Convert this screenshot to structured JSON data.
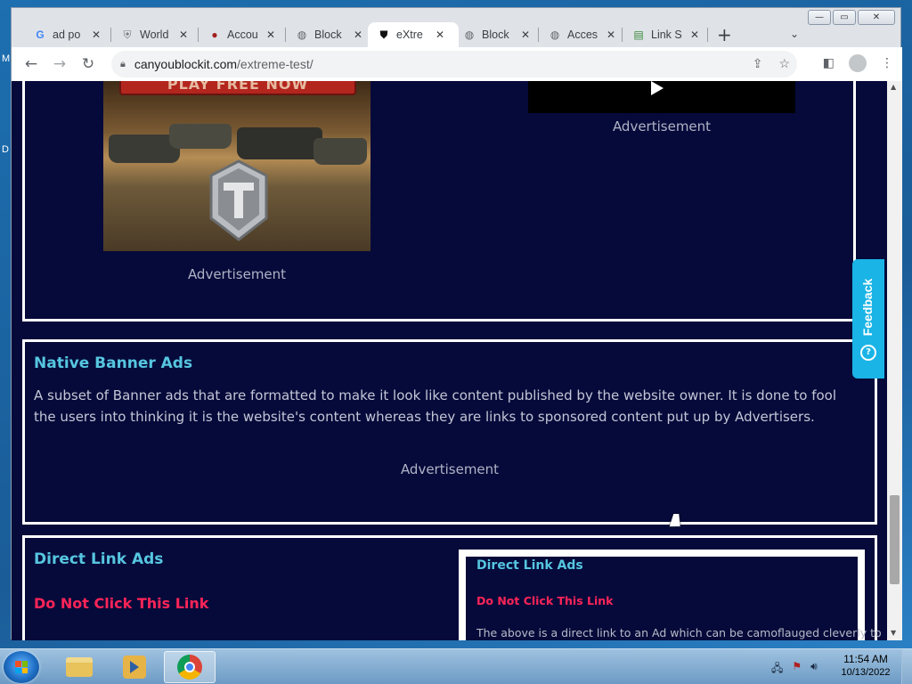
{
  "desktop": {
    "letter_top": "M",
    "letter_bottom": "D"
  },
  "window_controls": {
    "minimize": "—",
    "maximize": "▭",
    "close": "✕"
  },
  "tabs": [
    {
      "title": "ad po",
      "favicon": "google-icon",
      "active": false
    },
    {
      "title": "World",
      "favicon": "shield-icon",
      "active": false
    },
    {
      "title": "Accou",
      "favicon": "circle-logo-icon",
      "active": false
    },
    {
      "title": "Block",
      "favicon": "globe-icon",
      "active": false
    },
    {
      "title": "eXtre",
      "favicon": "shield-icon",
      "active": true
    },
    {
      "title": "Block",
      "favicon": "globe-icon",
      "active": false
    },
    {
      "title": "Acces",
      "favicon": "globe-icon",
      "active": false
    },
    {
      "title": "Link S",
      "favicon": "link-icon",
      "active": false
    }
  ],
  "toolbar": {
    "back": "←",
    "forward": "→",
    "reload": "↻",
    "url_domain": "canyoublockit.com",
    "url_path": "/extreme-test/"
  },
  "page": {
    "ad_label_left": "Advertisement",
    "ad_label_right": "Advertisement",
    "tank_banner_text": "PLAY FREE NOW",
    "native": {
      "title": "Native Banner Ads",
      "text": "A subset of Banner ads that are formatted to make it look like content published by the website owner. It is done to fool the users into thinking it is the website's content whereas they are links to sponsored content put up by Advertisers.",
      "ad_label": "Advertisement"
    },
    "direct": {
      "title": "Direct Link Ads",
      "warning": "Do Not Click This Link",
      "inner_title": "Direct Link Ads",
      "inner_warning": "Do Not Click This Link",
      "inner_text": "The above is a direct link to an Ad which can be camoflauged cleverly to"
    },
    "feedback_label": "Feedback"
  },
  "taskbar": {
    "time": "11:54 AM",
    "date": "10/13/2022"
  },
  "colors": {
    "page_bg": "#060a3a",
    "section_title": "#56c6e0",
    "warning_text": "#ff2458",
    "feedback_bg": "#1ab4e6"
  }
}
